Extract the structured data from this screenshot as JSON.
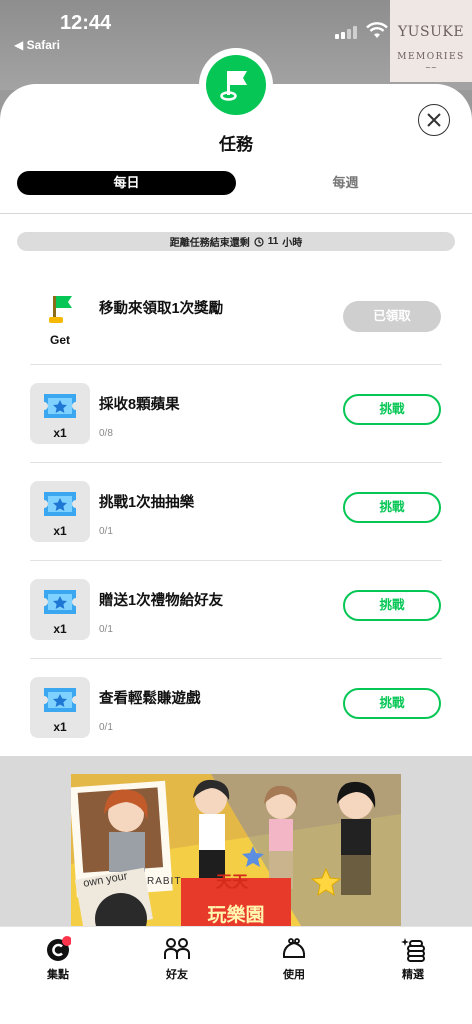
{
  "status_bar": {
    "time": "12:44",
    "back_app": "◀ Safari"
  },
  "watermark": {
    "line1": "YUSUKE",
    "line2": "MEMORIES"
  },
  "header": {
    "title": "任務"
  },
  "tabs": [
    {
      "label": "每日",
      "active": true
    },
    {
      "label": "每週",
      "active": false
    }
  ],
  "countdown": {
    "text": "距離任務結束還剩",
    "value": "11",
    "unit": "小時"
  },
  "login_task": {
    "icon_label": "Get",
    "name": "移動來領取1次獎勵",
    "button": "已領取"
  },
  "tasks": [
    {
      "reward": "x1",
      "name": "採收8顆蘋果",
      "progress": "0/8",
      "button": "挑戰"
    },
    {
      "reward": "x1",
      "name": "挑戰1次抽抽樂",
      "progress": "0/1",
      "button": "挑戰"
    },
    {
      "reward": "x1",
      "name": "贈送1次禮物給好友",
      "progress": "0/1",
      "button": "挑戰"
    },
    {
      "reward": "x1",
      "name": "查看輕鬆賺遊戲",
      "progress": "0/1",
      "button": "挑戰"
    }
  ],
  "banner": {
    "sign_line1": "天天",
    "sign_line2": "玩樂園",
    "tote_text": "own your",
    "tote_text2": "RABIT"
  },
  "bottom_nav": [
    {
      "label": "集點",
      "icon": "points-icon"
    },
    {
      "label": "好友",
      "icon": "friends-icon"
    },
    {
      "label": "使用",
      "icon": "wallet-icon"
    },
    {
      "label": "精選",
      "icon": "featured-icon"
    }
  ],
  "colors": {
    "brand_green": "#06c755",
    "badge_red": "#ff334b"
  }
}
